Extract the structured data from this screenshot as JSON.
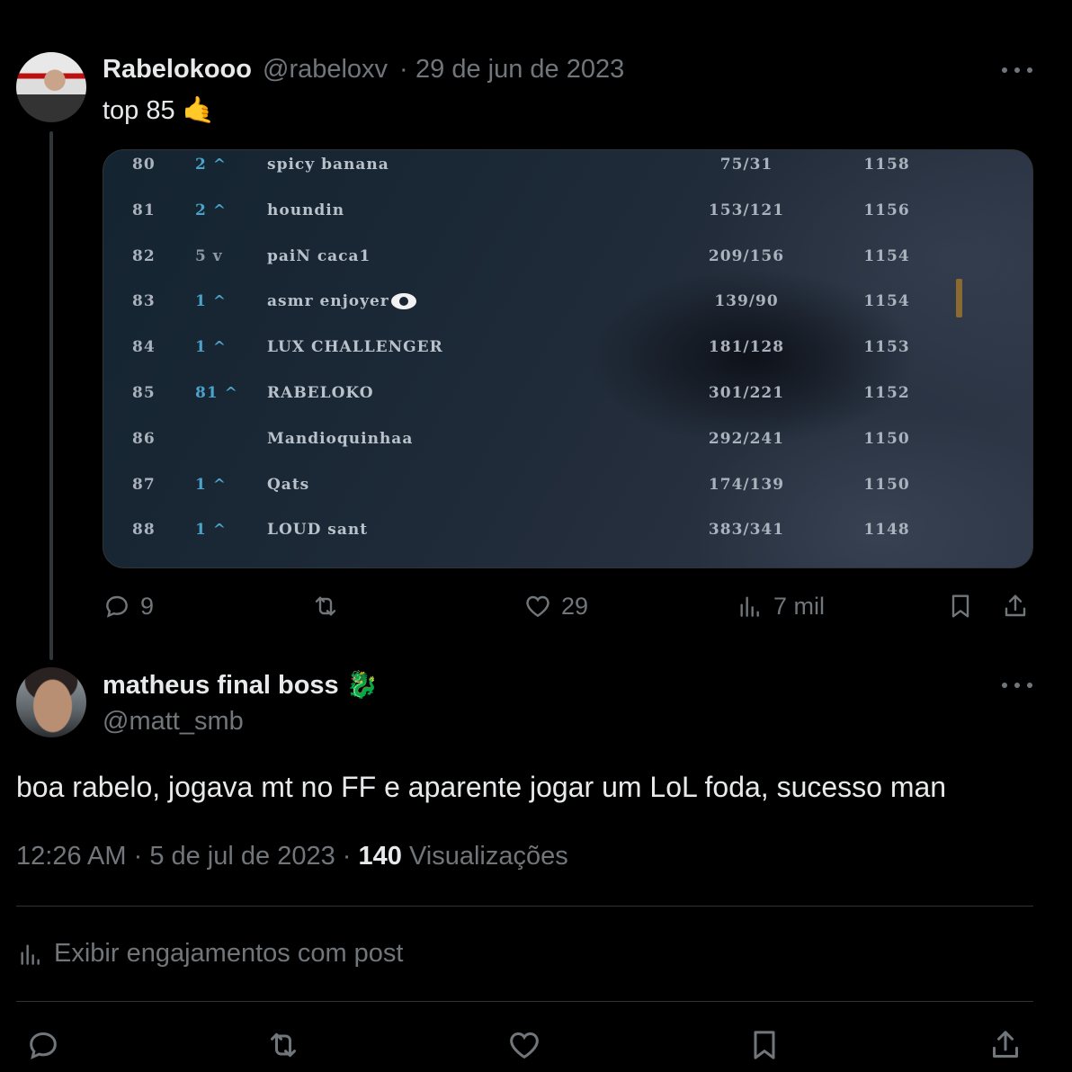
{
  "tweet1": {
    "display_name": "Rabelokooo",
    "handle": "@rabeloxv",
    "separator": "·",
    "date": "29 de jun de 2023",
    "text": "top 85 🤙",
    "actions": {
      "replies": "9",
      "likes": "29",
      "views": "7 mil"
    },
    "leaderboard": [
      {
        "rank": "80",
        "change": "2 ^",
        "name": "spicy banana",
        "wl": "75/31",
        "lp": "1158"
      },
      {
        "rank": "81",
        "change": "2 ^",
        "name": "houndin",
        "wl": "153/121",
        "lp": "1156"
      },
      {
        "rank": "82",
        "change": "5 v",
        "name": "paiN caca1",
        "wl": "209/156",
        "lp": "1154"
      },
      {
        "rank": "83",
        "change": "1 ^",
        "name": "asmr enjoyer",
        "wl": "139/90",
        "lp": "1154"
      },
      {
        "rank": "84",
        "change": "1 ^",
        "name": "LUX CHALLENGER",
        "wl": "181/128",
        "lp": "1153"
      },
      {
        "rank": "85",
        "change": "81 ^",
        "name": "RABELOKO",
        "wl": "301/221",
        "lp": "1152"
      },
      {
        "rank": "86",
        "change": "",
        "name": "Mandioquinhaa",
        "wl": "292/241",
        "lp": "1150"
      },
      {
        "rank": "87",
        "change": "1 ^",
        "name": "Qats",
        "wl": "174/139",
        "lp": "1150"
      },
      {
        "rank": "88",
        "change": "1 ^",
        "name": "LOUD sant",
        "wl": "383/341",
        "lp": "1148"
      }
    ]
  },
  "tweet2": {
    "display_name": "matheus final boss 🐉",
    "handle": "@matt_smb",
    "text": "boa rabelo, jogava mt no FF e aparente jogar um LoL foda, sucesso man",
    "time": "12:26 AM",
    "date": "5 de jul de 2023",
    "views_count": "140",
    "views_label": "Visualizações",
    "engagements_link": "Exibir engajamentos com post"
  },
  "colors": {
    "background": "#000000",
    "text": "#e7e9ea",
    "muted": "#71767b",
    "border": "#2f3336",
    "rank_up": "#4ba3c9"
  },
  "icons": [
    "reply-icon",
    "retweet-icon",
    "like-icon",
    "views-icon",
    "bookmark-icon",
    "share-icon",
    "more-icon"
  ]
}
